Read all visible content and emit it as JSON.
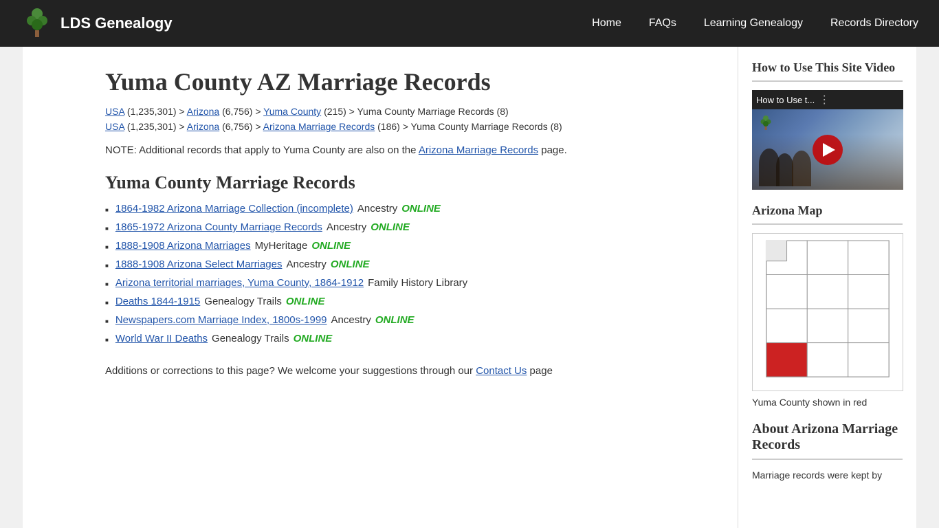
{
  "nav": {
    "logo_text": "LDS Genealogy",
    "links": [
      {
        "label": "Home",
        "href": "#"
      },
      {
        "label": "FAQs",
        "href": "#"
      },
      {
        "label": "Learning Genealogy",
        "href": "#"
      },
      {
        "label": "Records Directory",
        "href": "#"
      }
    ]
  },
  "main": {
    "page_title": "Yuma County AZ Marriage Records",
    "breadcrumb1": {
      "usa_text": "USA",
      "usa_count": "(1,235,301)",
      "separator1": " > ",
      "arizona_text": "Arizona",
      "arizona_count": "(6,756)",
      "separator2": " > ",
      "county_text": "Yuma County",
      "county_count": "(215)",
      "separator3": " > ",
      "end_text": "Yuma County Marriage Records (8)"
    },
    "breadcrumb2": {
      "usa_text": "USA",
      "usa_count": "(1,235,301)",
      "separator1": " > ",
      "arizona_text": "Arizona",
      "arizona_count": "(6,756)",
      "separator2": " > ",
      "marriage_text": "Arizona Marriage Records",
      "marriage_count": "(186)",
      "separator3": " > ",
      "end_text": "Yuma County Marriage Records (8)"
    },
    "note_prefix": "NOTE: Additional records that apply to Yuma County are also on the ",
    "note_link": "Arizona Marriage Records",
    "note_suffix": " page.",
    "section_title": "Yuma County Marriage Records",
    "records": [
      {
        "link_text": "1864-1982 Arizona Marriage Collection (incomplete)",
        "provider": "Ancestry",
        "online": true,
        "online_text": "ONLINE"
      },
      {
        "link_text": "1865-1972 Arizona County Marriage Records",
        "provider": "Ancestry",
        "online": true,
        "online_text": "ONLINE"
      },
      {
        "link_text": "1888-1908 Arizona Marriages",
        "provider": "MyHeritage",
        "online": true,
        "online_text": "ONLINE"
      },
      {
        "link_text": "1888-1908 Arizona Select Marriages",
        "provider": "Ancestry",
        "online": true,
        "online_text": "ONLINE"
      },
      {
        "link_text": "Arizona territorial marriages, Yuma County, 1864-1912",
        "provider": "Family History Library",
        "online": false,
        "online_text": ""
      },
      {
        "link_text": "Deaths 1844-1915",
        "provider": "Genealogy Trails",
        "online": true,
        "online_text": "ONLINE"
      },
      {
        "link_text": "Newspapers.com Marriage Index, 1800s-1999",
        "provider": "Ancestry",
        "online": true,
        "online_text": "ONLINE"
      },
      {
        "link_text": "World War II Deaths",
        "provider": "Genealogy Trails",
        "online": true,
        "online_text": "ONLINE"
      }
    ],
    "corrections_prefix": "Additions or corrections to this page? We welcome your suggestions through our ",
    "corrections_link": "Contact Us",
    "corrections_suffix": " page"
  },
  "sidebar": {
    "video_section_title": "How to Use This Site Video",
    "video_title_bar": "How to Use t...",
    "map_section_title": "Arizona Map",
    "map_caption": "Yuma County shown in red",
    "about_section_title": "About Arizona Marriage Records",
    "about_text": "Marriage records were kept by"
  }
}
